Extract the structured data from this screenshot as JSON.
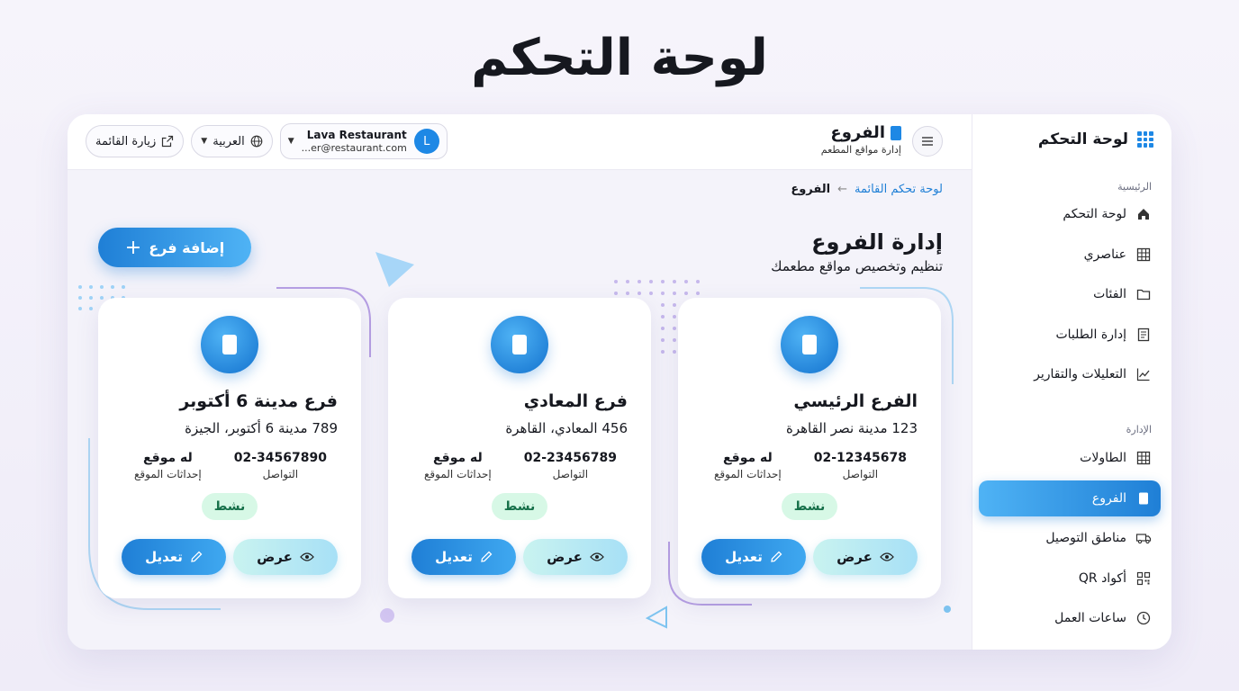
{
  "page_title": "لوحة التحكم",
  "sidebar": {
    "brand": "لوحة التحكم",
    "section_main": "الرئيسية",
    "main_items": [
      {
        "label": "لوحة التحكم",
        "icon": "home-icon"
      },
      {
        "label": "عناصري",
        "icon": "table-icon"
      },
      {
        "label": "الفئات",
        "icon": "folder-icon"
      },
      {
        "label": "إدارة الطلبات",
        "icon": "orders-icon"
      },
      {
        "label": "التعليلات والتقارير",
        "icon": "chart-icon"
      }
    ],
    "section_admin": "الإدارة",
    "admin_items": [
      {
        "label": "الطاولات",
        "icon": "table-icon"
      },
      {
        "label": "الفروع",
        "icon": "document-icon",
        "active": true
      },
      {
        "label": "مناطق التوصيل",
        "icon": "truck-icon"
      },
      {
        "label": "أكواد QR",
        "icon": "qr-icon"
      },
      {
        "label": "ساعات العمل",
        "icon": "clock-icon"
      }
    ]
  },
  "header": {
    "title": "الفروع",
    "subtitle": "إدارة مواقع المطعم",
    "visit_menu": "زيارة القائمة",
    "language": "العربية",
    "user_name": "Lava Restaurant",
    "user_email": "...er@restaurant.com",
    "avatar_letter": "L"
  },
  "breadcrumb": {
    "link": "لوحة تحكم القائمة",
    "current": "الفروع"
  },
  "page": {
    "heading": "إدارة الفروع",
    "description": "تنظيم وتخصيص مواقع مطعمك",
    "add_button": "إضافة فرع"
  },
  "branches": [
    {
      "name": "الفرع الرئيسي",
      "address": "123 مدينة نصر القاهرة",
      "phone": "02-12345678",
      "phone_label": "التواصل",
      "location": "له موقع",
      "location_label": "إحداثات الموقع",
      "status": "نشط",
      "view_label": "عرض",
      "edit_label": "تعديل"
    },
    {
      "name": "فرع المعادي",
      "address": "456 المعادي، القاهرة",
      "phone": "02-23456789",
      "phone_label": "التواصل",
      "location": "له موقع",
      "location_label": "إحداثات الموقع",
      "status": "نشط",
      "view_label": "عرض",
      "edit_label": "تعديل"
    },
    {
      "name": "فرع مدينة 6 أكتوبر",
      "address": "789 مدينة 6 أكتوبر، الجيزة",
      "phone": "02-34567890",
      "phone_label": "التواصل",
      "location": "له موقع",
      "location_label": "إحداثات الموقع",
      "status": "نشط",
      "view_label": "عرض",
      "edit_label": "تعديل"
    }
  ],
  "colors": {
    "accent": "#1f7fd6",
    "accent_light": "#4fb3f5",
    "status_bg": "#d7f8e6",
    "status_text": "#17704a"
  }
}
